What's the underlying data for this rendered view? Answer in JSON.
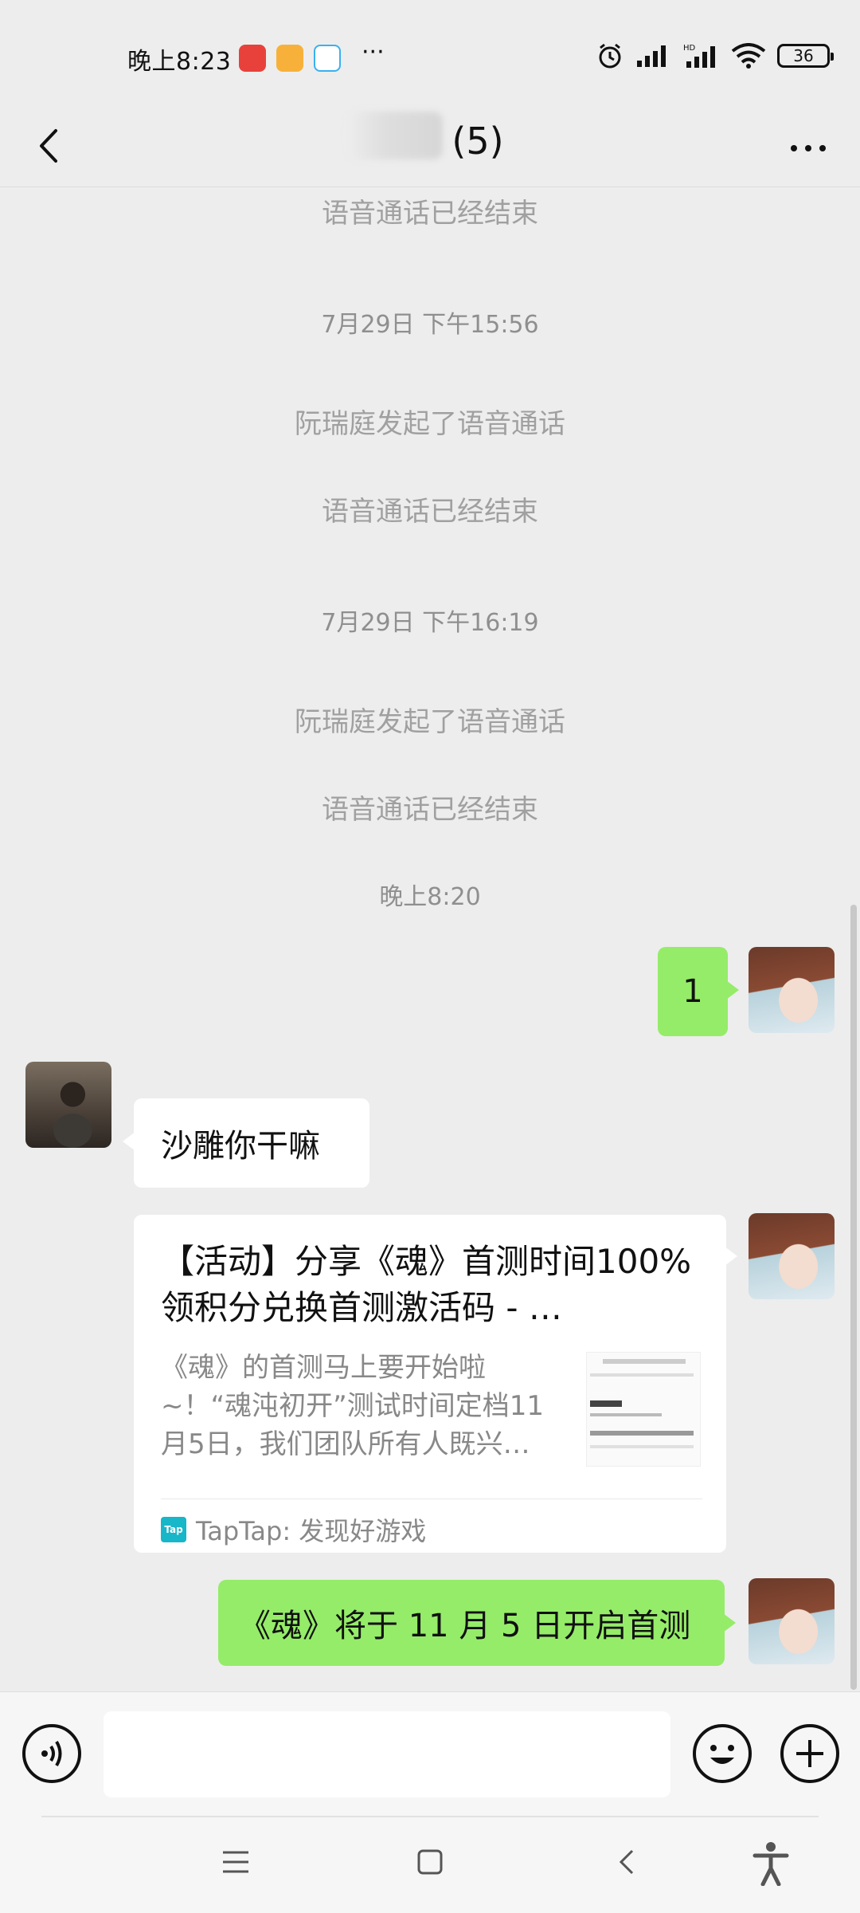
{
  "status_bar": {
    "time": "晚上8:23",
    "battery": "36",
    "icons": [
      "alarm-icon",
      "signal-icon",
      "hd-signal-icon",
      "wifi-icon",
      "battery-icon"
    ],
    "app_icons": [
      "red-app-icon",
      "orange-app-icon",
      "chat-app-icon"
    ]
  },
  "header": {
    "title": "(5)"
  },
  "messages": {
    "sys1": "语音通话已经结束",
    "ts1": "7月29日 下午15:56",
    "sys2": "阮瑞庭发起了语音通话",
    "sys3": "语音通话已经结束",
    "ts2": "7月29日 下午16:19",
    "sys4": "阮瑞庭发起了语音通话",
    "sys5": "语音通话已经结束",
    "ts3": "晚上8:20",
    "msg1": "1",
    "msg2": "沙雕你干嘛",
    "card": {
      "title": "【活动】分享《魂》首测时间100%领积分兑换首测激活码 - …",
      "description": "《魂》的首测马上要开始啦~！“魂沌初开”测试时间定档11月5日，我们团队所有人既兴…",
      "source": "TapTap: 发现好游戏",
      "source_icon_text": "Tap"
    },
    "msg3": "《魂》将于 11 月 5 日开启首测"
  },
  "input": {
    "value": "",
    "placeholder": ""
  },
  "colors": {
    "sent_bubble": "#95ec69",
    "received_bubble": "#ffffff",
    "background": "#ededed"
  }
}
